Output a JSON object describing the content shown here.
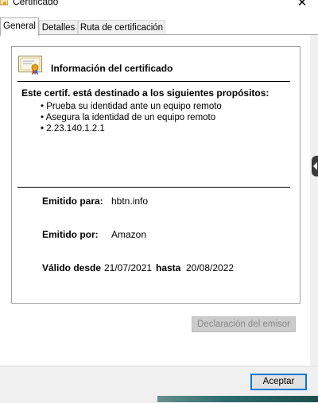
{
  "window": {
    "title": "Certificado",
    "close_symbol": "✕"
  },
  "tabs": [
    {
      "label": "General",
      "active": true
    },
    {
      "label": "Detalles",
      "active": false
    },
    {
      "label": "Ruta de certificación",
      "active": false
    }
  ],
  "certificate": {
    "info_title": "Información del certificado",
    "purposes_title": "Este certif. está destinado a los siguientes propósitos:",
    "purposes": [
      "Prueba su identidad ante un equipo remoto",
      "Asegura la identidad de un equipo remoto",
      "2.23.140.1.2.1"
    ],
    "issued_to_label": "Emitido para:",
    "issued_to": "hbtn.info",
    "issued_by_label": "Emitido por:",
    "issued_by": "Amazon",
    "valid_from_label": "Válido desde",
    "valid_from": "21/07/2021",
    "valid_to_label": "hasta",
    "valid_to": "20/08/2022"
  },
  "buttons": {
    "issuer_statement": "Declaración del emisor",
    "accept": "Aceptar"
  },
  "icons": {
    "window": "certificate-icon",
    "close": "close-icon",
    "info": "certificate-ribbon-icon"
  },
  "colors": {
    "accent": "#0078d7",
    "disabled_text": "#8a8a8a"
  }
}
